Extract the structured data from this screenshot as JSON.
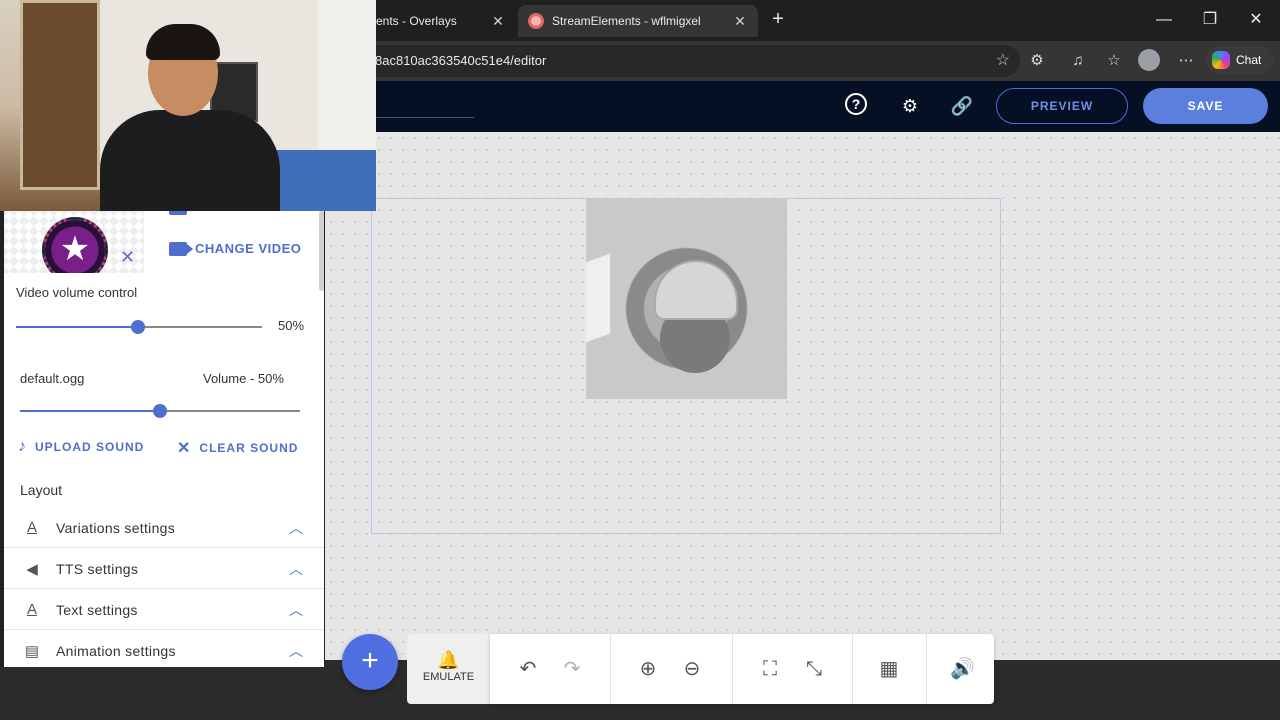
{
  "browser": {
    "tabs": [
      {
        "title": "ents - Overlays",
        "active": false
      },
      {
        "title": "StreamElements - wflmigxel",
        "active": true
      }
    ],
    "url": "8ac810ac363540c51e4/editor",
    "copilot_label": "Chat"
  },
  "header": {
    "preview_label": "PREVIEW",
    "save_label": "SAVE"
  },
  "panel": {
    "change_video_label": "CHANGE VIDEO",
    "video_volume": {
      "label": "Video volume control",
      "value_text": "50%",
      "value": 0.5
    },
    "sound": {
      "file": "default.ogg",
      "volume_text": "Volume - 50%",
      "value": 0.5
    },
    "upload_sound_label": "UPLOAD SOUND",
    "clear_sound_label": "CLEAR SOUND",
    "layout_label": "Layout",
    "sections": [
      {
        "title": "Variations settings",
        "icon": "text-format-icon"
      },
      {
        "title": "TTS settings",
        "icon": "speaker-icon"
      },
      {
        "title": "Text settings",
        "icon": "text-format-icon"
      },
      {
        "title": "Animation settings",
        "icon": "animation-icon"
      }
    ]
  },
  "toolbar": {
    "emulate_label": "EMULATE"
  },
  "colors": {
    "accent": "#4f6ed0",
    "header_bg": "#061025",
    "save_bg": "#5b7fdc"
  }
}
